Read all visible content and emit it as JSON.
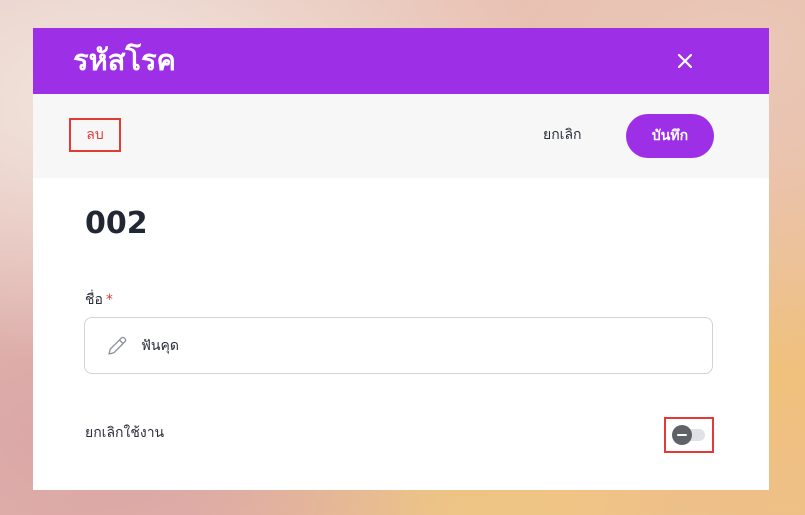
{
  "modal": {
    "title": "รหัสโรค",
    "close_icon": "close-icon"
  },
  "toolbar": {
    "delete_label": "ลบ",
    "cancel_label": "ยกเลิก",
    "save_label": "บันทึก"
  },
  "record": {
    "code": "002"
  },
  "form": {
    "name_label": "ชื่อ",
    "required_mark": "*",
    "name_value": "ฟันคุด",
    "name_icon": "pencil-icon",
    "inactive_label": "ยกเลิกใช้งาน",
    "inactive_toggle_on": false
  },
  "colors": {
    "brand": "#9d2fe6",
    "danger": "#e53935",
    "text": "#2b2f3a"
  }
}
